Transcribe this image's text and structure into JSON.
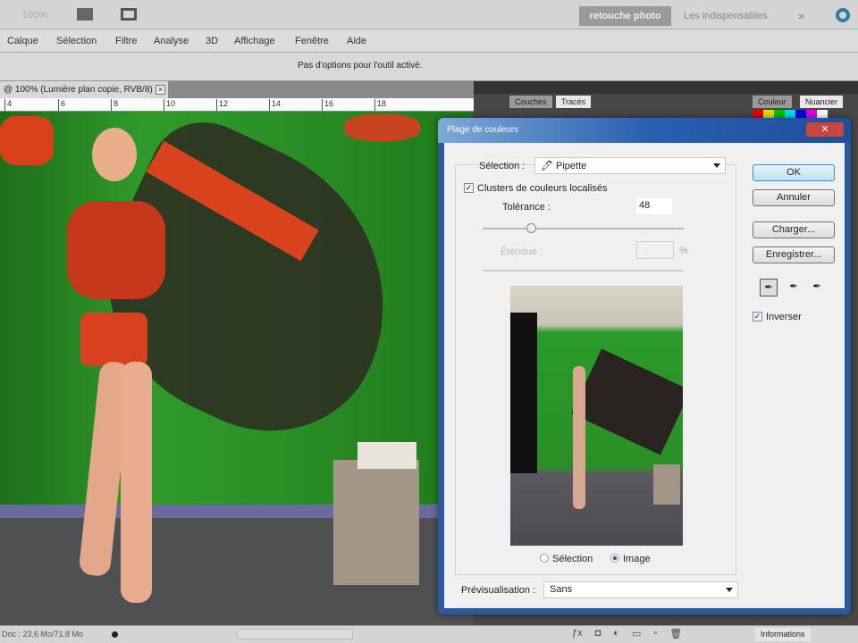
{
  "appbar": {
    "zoom": "100%",
    "workspace_active": "retouche photo",
    "workspace_other": "Les indispensables",
    "more": "»"
  },
  "menu": [
    "Calque",
    "Sélection",
    "Filtre",
    "Analyse",
    "3D",
    "Affichage",
    "Fenêtre",
    "Aide"
  ],
  "options_text": "Pas d'options pour l'outil activé.",
  "document": {
    "tab_title": "@ 100% (Lumière plan copie, RVB/8) *",
    "ruler": [
      "4",
      "6",
      "8",
      "10",
      "12",
      "14",
      "16",
      "18"
    ]
  },
  "panels": {
    "tabs_left": [
      "Couches",
      "Tracés"
    ],
    "tabs_right": [
      "Couleur",
      "Nuancier"
    ],
    "bottom_tab": "Informations",
    "swatches": [
      "#e00000",
      "#e0e000",
      "#00c000",
      "#00e0e0",
      "#0000e0",
      "#e000e0",
      "#ffffff"
    ]
  },
  "status": {
    "doc": "Doc : 23,6 Mo/71,8 Mo"
  },
  "dialog": {
    "title": "Plage de couleurs",
    "selection_label": "Sélection :",
    "selection_value": "Pipette",
    "clusters_label": "Clusters de couleurs localisés",
    "clusters_checked": true,
    "tolerance_label": "Tolérance :",
    "tolerance_value": "48",
    "tolerance_slider_fraction": 0.24,
    "range_label": "Étendue :",
    "range_unit": "%",
    "radio_selection": "Sélection",
    "radio_image": "Image",
    "radio_selected": "Image",
    "preview_label": "Prévisualisation :",
    "preview_value": "Sans",
    "ok": "OK",
    "cancel": "Annuler",
    "load": "Charger...",
    "save": "Enregistrer...",
    "invert_label": "Inverser",
    "invert_checked": true
  }
}
